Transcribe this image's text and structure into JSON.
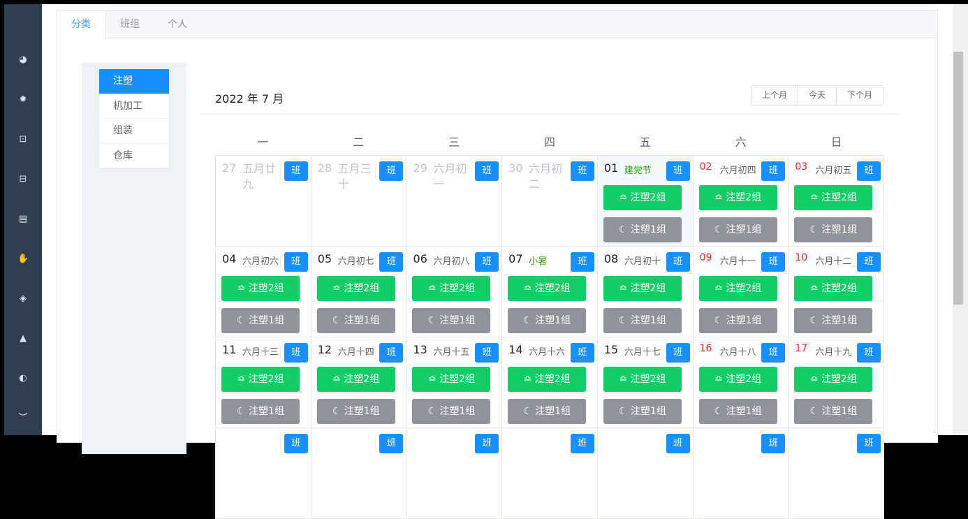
{
  "sidebar": {
    "icons": [
      "dashboard-icon",
      "settings-icon",
      "monitor-icon",
      "briefcase-icon",
      "document-icon",
      "thumb-icon",
      "box-icon",
      "lock-icon",
      "toggle-icon",
      "eye-icon"
    ]
  },
  "tabs": [
    {
      "label": "分类",
      "active": true
    },
    {
      "label": "班组"
    },
    {
      "label": "个人"
    }
  ],
  "categories": [
    {
      "label": "注塑",
      "active": true
    },
    {
      "label": "机加工"
    },
    {
      "label": "组装"
    },
    {
      "label": "仓库"
    }
  ],
  "calendar": {
    "title": "2022 年 7 月",
    "nav": [
      "上个月",
      "今天",
      "下个月"
    ],
    "weekdays": [
      "一",
      "二",
      "三",
      "四",
      "五",
      "六",
      "日"
    ],
    "shift_label": "班",
    "day_shift": "注塑2组",
    "night_shift": "注塑1组",
    "weeks": [
      [
        {
          "d": "27",
          "l": "五月廿九",
          "other": true
        },
        {
          "d": "28",
          "l": "五月三十",
          "other": true
        },
        {
          "d": "29",
          "l": "六月初一",
          "other": true
        },
        {
          "d": "30",
          "l": "六月初二",
          "other": true
        },
        {
          "d": "01",
          "l": "建党节",
          "fest": true,
          "today": true
        },
        {
          "d": "02",
          "l": "六月初四",
          "we": true
        },
        {
          "d": "03",
          "l": "六月初五",
          "we": true
        }
      ],
      [
        {
          "d": "04",
          "l": "六月初六"
        },
        {
          "d": "05",
          "l": "六月初七"
        },
        {
          "d": "06",
          "l": "六月初八"
        },
        {
          "d": "07",
          "l": "小暑",
          "fest": true
        },
        {
          "d": "08",
          "l": "六月初十"
        },
        {
          "d": "09",
          "l": "六月十一",
          "we": true
        },
        {
          "d": "10",
          "l": "六月十二",
          "we": true
        }
      ],
      [
        {
          "d": "11",
          "l": "六月十三"
        },
        {
          "d": "12",
          "l": "六月十四"
        },
        {
          "d": "13",
          "l": "六月十五"
        },
        {
          "d": "14",
          "l": "六月十六"
        },
        {
          "d": "15",
          "l": "六月十七"
        },
        {
          "d": "16",
          "l": "六月十八",
          "we": true
        },
        {
          "d": "17",
          "l": "六月十九",
          "we": true
        }
      ],
      [
        {
          "blank": true
        },
        {
          "blank": true
        },
        {
          "blank": true
        },
        {
          "blank": true
        },
        {
          "blank": true
        },
        {
          "blank": true
        },
        {
          "blank": true
        }
      ]
    ]
  }
}
